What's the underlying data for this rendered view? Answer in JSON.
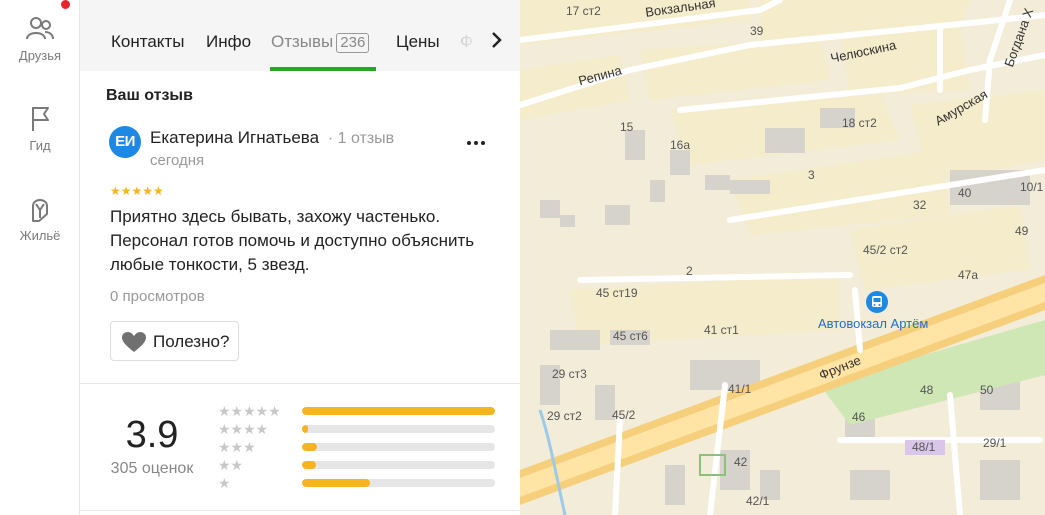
{
  "rail": {
    "items": [
      {
        "label": "Друзья",
        "icon": "friends-icon"
      },
      {
        "label": "Гид",
        "icon": "flag-icon"
      },
      {
        "label": "Жильё",
        "icon": "housing-icon"
      }
    ]
  },
  "tabs": [
    {
      "label": "Контакты"
    },
    {
      "label": "Инфо"
    },
    {
      "label": "Отзывы",
      "count": "236"
    },
    {
      "label": "Цены"
    },
    {
      "label": "Ф"
    }
  ],
  "review": {
    "section_title": "Ваш отзыв",
    "avatar_initials": "ЕИ",
    "author": "Екатерина Игнатьева",
    "author_meta": "· 1 отзыв",
    "date": "сегодня",
    "stars": "★★★★★",
    "text": "Приятно здесь бывать, захожу частенько. Персонал готов помочь и доступно объяснить любые тонкости, 5 звезд.",
    "views": "0 просмотров",
    "helpful_label": "Полезно?"
  },
  "rating": {
    "score": "3.9",
    "count_label": "305 оценок",
    "distribution": [
      {
        "stars": "★★★★★",
        "fraction": 1.0
      },
      {
        "stars": "★★★★",
        "fraction": 0.03
      },
      {
        "stars": "★★★",
        "fraction": 0.08
      },
      {
        "stars": "★★",
        "fraction": 0.07
      },
      {
        "stars": "★",
        "fraction": 0.35
      }
    ]
  },
  "map": {
    "streets": [
      "Вокзальная",
      "Репина",
      "Челюскина",
      "Амурская",
      "Богдана Х",
      "Фрунзе"
    ],
    "building_labels": [
      "17 ст2",
      "39",
      "15",
      "16а",
      "18 ст2",
      "3",
      "40",
      "10/1",
      "32",
      "49",
      "45/2 ст2",
      "2",
      "47а",
      "45 ст19",
      "41 ст1",
      "45 ст6",
      "29 ст3",
      "41/1",
      "48",
      "50",
      "29 ст2",
      "45/2",
      "46",
      "48/1",
      "29/1",
      "42",
      "42/1"
    ],
    "bus_stop_label": "Автовокзал Артём"
  },
  "colors": {
    "accent_green": "#2aa52a",
    "star_yellow": "#f8b420",
    "avatar_blue": "#1e88e5",
    "badge_red": "#e5262b"
  }
}
